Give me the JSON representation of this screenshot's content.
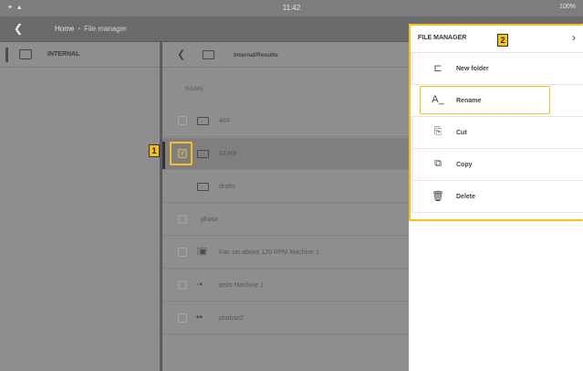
{
  "status": {
    "time": "11:42",
    "battery": "100%"
  },
  "nav": {
    "crumb_home": "Home",
    "crumb_current": "File manager"
  },
  "drive": {
    "label": "INTERNAL"
  },
  "files": {
    "path": "Internal/Results",
    "column_header": "NAME",
    "rows": [
      {
        "name": "404",
        "type": "folder"
      },
      {
        "name": "ACME",
        "type": "folder",
        "selected": true
      },
      {
        "name": "drafts",
        "type": "folder"
      },
      {
        "name": "phase",
        "type": "file"
      },
      {
        "name": "Fan set above 120 RPM Machine 1",
        "type": "machine"
      },
      {
        "name": "tests Machine 1",
        "type": "machine"
      },
      {
        "name": "phabse2",
        "type": "machine"
      }
    ]
  },
  "callouts": {
    "one": "1",
    "two": "2"
  },
  "panel": {
    "title": "FILE MANAGER",
    "items": [
      {
        "label": "New folder",
        "icon": "new-folder-icon",
        "glyph": "⊏"
      },
      {
        "label": "Rename",
        "icon": "rename-icon",
        "glyph": "A_"
      },
      {
        "label": "Cut",
        "icon": "cut-icon",
        "glyph": "⎘"
      },
      {
        "label": "Copy",
        "icon": "copy-icon",
        "glyph": "⧉"
      },
      {
        "label": "Delete",
        "icon": "trash-icon",
        "glyph": "🗑"
      }
    ]
  }
}
